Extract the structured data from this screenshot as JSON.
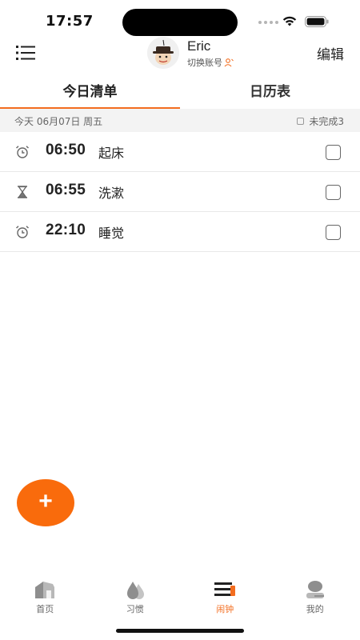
{
  "status_bar": {
    "time": "17:57"
  },
  "header": {
    "user_name": "Eric",
    "switch_account_label": "切换账号",
    "edit_label": "编辑"
  },
  "tabs": [
    {
      "label": "今日清单",
      "active": true
    },
    {
      "label": "日历表",
      "active": false
    }
  ],
  "date_strip": {
    "date_text": "今天 06月07日 周五",
    "incomplete_text": "未完成3"
  },
  "alarms": [
    {
      "icon": "alarm-clock-icon",
      "time": "06:50",
      "label": "起床",
      "checked": false
    },
    {
      "icon": "hourglass-icon",
      "time": "06:55",
      "label": "洗漱",
      "checked": false
    },
    {
      "icon": "alarm-clock-icon",
      "time": "22:10",
      "label": "睡觉",
      "checked": false
    }
  ],
  "fab": {
    "symbol": "+"
  },
  "tab_bar": [
    {
      "label": "首页",
      "icon": "home-icon",
      "active": false
    },
    {
      "label": "习惯",
      "icon": "drops-icon",
      "active": false
    },
    {
      "label": "闹钟",
      "icon": "alarm-bars-icon",
      "active": true
    },
    {
      "label": "我的",
      "icon": "profile-icon",
      "active": false
    }
  ],
  "colors": {
    "accent": "#f36d1f",
    "fab": "#f96b0c",
    "strip": "#f3f3f3"
  }
}
